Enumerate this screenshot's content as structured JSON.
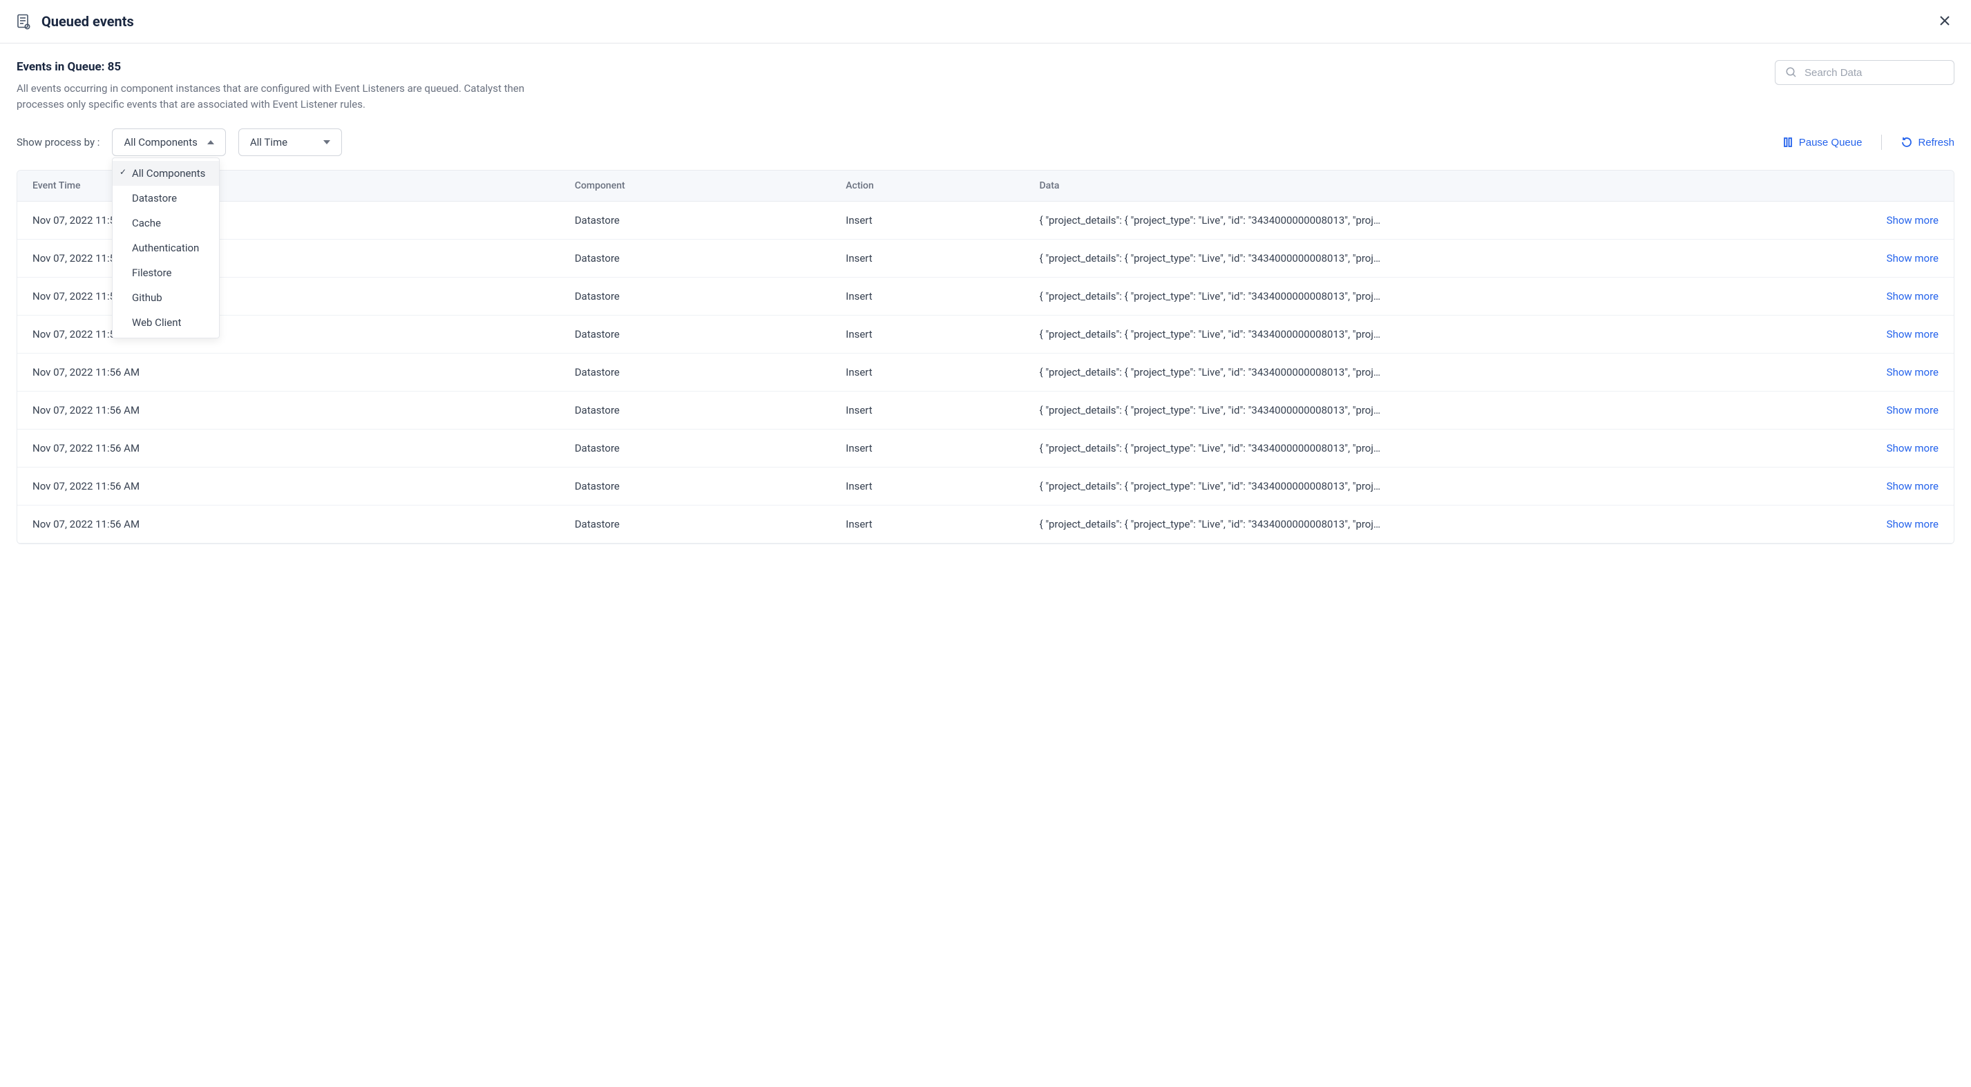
{
  "header": {
    "title": "Queued events"
  },
  "queue": {
    "count_label": "Events in Queue: 85",
    "description": "All events occurring in component instances that are configured with Event Listeners are queued. Catalyst then processes only specific events that are associated with Event Listener rules."
  },
  "search": {
    "placeholder": "Search Data"
  },
  "filters": {
    "label": "Show process by :",
    "component_select": "All Components",
    "time_select": "All Time",
    "component_options": [
      "All Components",
      "Datastore",
      "Cache",
      "Authentication",
      "Filestore",
      "Github",
      "Web Client"
    ]
  },
  "actions": {
    "pause": "Pause Queue",
    "refresh": "Refresh"
  },
  "table": {
    "columns": {
      "time": "Event Time",
      "component": "Component",
      "action": "Action",
      "data": "Data"
    },
    "show_more": "Show more",
    "rows": [
      {
        "time": "Nov 07, 2022 11:56 AM",
        "component": "Datastore",
        "action": "Insert",
        "data": "{ \"project_details\": { \"project_type\": \"Live\", \"id\": \"3434000000008013\", \"proj…"
      },
      {
        "time": "Nov 07, 2022 11:56 AM",
        "component": "Datastore",
        "action": "Insert",
        "data": "{ \"project_details\": { \"project_type\": \"Live\", \"id\": \"3434000000008013\", \"proj…"
      },
      {
        "time": "Nov 07, 2022 11:56 AM",
        "component": "Datastore",
        "action": "Insert",
        "data": "{ \"project_details\": { \"project_type\": \"Live\", \"id\": \"3434000000008013\", \"proj…"
      },
      {
        "time": "Nov 07, 2022 11:56 AM",
        "component": "Datastore",
        "action": "Insert",
        "data": "{ \"project_details\": { \"project_type\": \"Live\", \"id\": \"3434000000008013\", \"proj…"
      },
      {
        "time": "Nov 07, 2022 11:56 AM",
        "component": "Datastore",
        "action": "Insert",
        "data": "{ \"project_details\": { \"project_type\": \"Live\", \"id\": \"3434000000008013\", \"proj…"
      },
      {
        "time": "Nov 07, 2022 11:56 AM",
        "component": "Datastore",
        "action": "Insert",
        "data": "{ \"project_details\": { \"project_type\": \"Live\", \"id\": \"3434000000008013\", \"proj…"
      },
      {
        "time": "Nov 07, 2022 11:56 AM",
        "component": "Datastore",
        "action": "Insert",
        "data": "{ \"project_details\": { \"project_type\": \"Live\", \"id\": \"3434000000008013\", \"proj…"
      },
      {
        "time": "Nov 07, 2022 11:56 AM",
        "component": "Datastore",
        "action": "Insert",
        "data": "{ \"project_details\": { \"project_type\": \"Live\", \"id\": \"3434000000008013\", \"proj…"
      },
      {
        "time": "Nov 07, 2022 11:56 AM",
        "component": "Datastore",
        "action": "Insert",
        "data": "{ \"project_details\": { \"project_type\": \"Live\", \"id\": \"3434000000008013\", \"proj…"
      }
    ]
  }
}
